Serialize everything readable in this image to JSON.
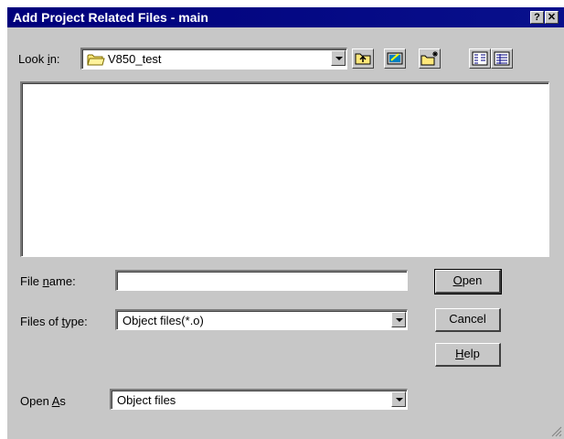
{
  "window": {
    "title": "Add Project Related Files - main",
    "help_glyph": "?",
    "close_glyph": "✕"
  },
  "look_in": {
    "label_pre": "Look ",
    "label_accel": "i",
    "label_post": "n:",
    "value": "V850_test"
  },
  "toolbar": {
    "icons": [
      "up-folder-icon",
      "desktop-icon",
      "new-folder-icon",
      "list-view-icon",
      "details-view-icon"
    ]
  },
  "file_name": {
    "label_pre": "File ",
    "label_accel": "n",
    "label_post": "ame:",
    "value": ""
  },
  "files_of_type": {
    "label_pre": "Files of ",
    "label_accel": "t",
    "label_post": "ype:",
    "value": "Object files(*.o)"
  },
  "open_as": {
    "label_pre": "Open ",
    "label_accel": "A",
    "label_post": "s",
    "value": "Object files"
  },
  "buttons": {
    "open_accel": "O",
    "open_rest": "pen",
    "cancel": "Cancel",
    "help_accel": "H",
    "help_rest": "elp"
  },
  "colors": {
    "title_bar": "#00007b",
    "face": "#c7c7c7"
  }
}
